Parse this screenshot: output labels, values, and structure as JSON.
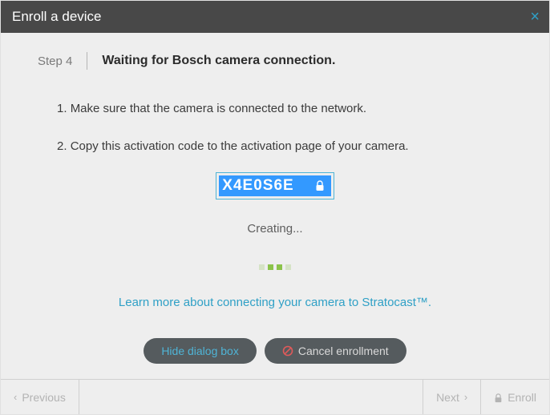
{
  "title": "Enroll a device",
  "step": {
    "label": "Step 4",
    "heading": "Waiting for Bosch camera connection."
  },
  "instructions": [
    "Make sure that the camera is connected to the network.",
    "Copy this activation code to the activation page of your camera."
  ],
  "activation_code": "X4E0S6E",
  "status_text": "Creating...",
  "learn_more": "Learn more about connecting your camera to Stratocast™.",
  "buttons": {
    "hide": "Hide dialog box",
    "cancel": "Cancel enrollment"
  },
  "footer": {
    "previous": "Previous",
    "next": "Next",
    "enroll": "Enroll"
  }
}
